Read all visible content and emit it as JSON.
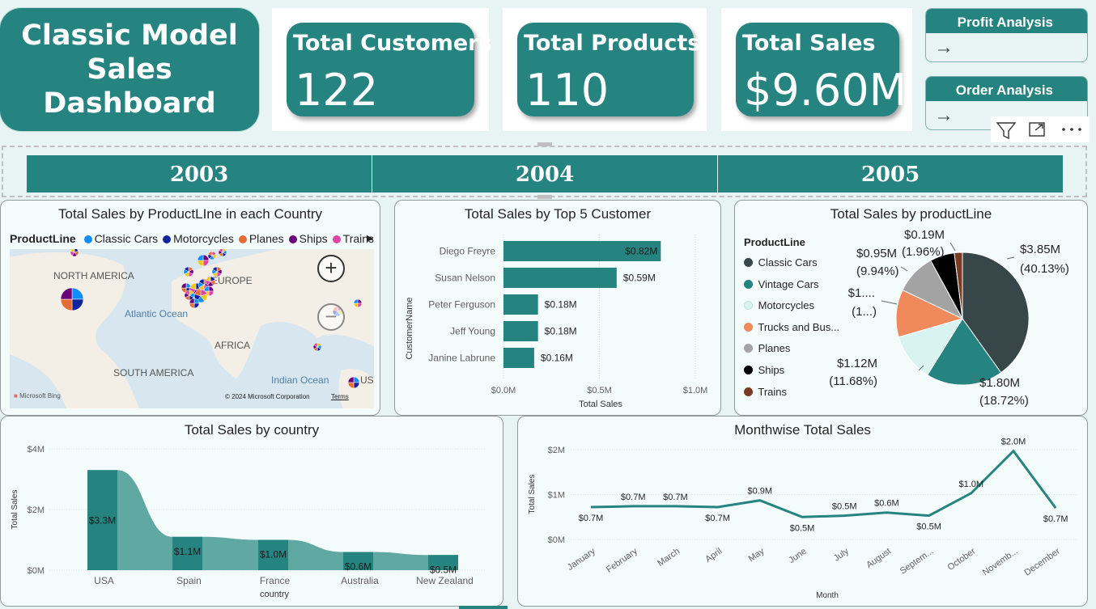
{
  "header": {
    "title_line1": "Classic Model",
    "title_line2": "Sales Dashboard"
  },
  "kpis": [
    {
      "label": "Total Customers",
      "value": "122"
    },
    {
      "label": "Total Products",
      "value": "110"
    },
    {
      "label": "Total Sales",
      "value": "$9.60M"
    }
  ],
  "nav": {
    "profit_label": "Profit Analysis",
    "order_label": "Order Analysis",
    "arrow_icon": "arrow-right-icon"
  },
  "visual_toolbar": {
    "filter_icon": "filter-icon",
    "focus_icon": "focus-mode-icon",
    "more_icon": "more-options-icon"
  },
  "year_slicer": {
    "years": [
      "2003",
      "2004",
      "2005"
    ]
  },
  "map_panel": {
    "title": "Total Sales by ProductLIne in each Country",
    "legend_title": "ProductLine",
    "legend": [
      {
        "label": "Classic Cars",
        "color": "#118DFF"
      },
      {
        "label": "Motorcycles",
        "color": "#12239E"
      },
      {
        "label": "Planes",
        "color": "#E66C37"
      },
      {
        "label": "Ships",
        "color": "#6B007B"
      },
      {
        "label": "Trains",
        "color": "#E044A7"
      }
    ],
    "labels": {
      "north_america": "NORTH AMERICA",
      "europe": "EUROPE",
      "atlantic": "Atlantic Ocean",
      "africa": "AFRICA",
      "south_america": "SOUTH AMERICA",
      "indian": "Indian Ocean",
      "asia_cut": "USTI",
      "bing": "Microsoft Bing",
      "copyright": "© 2024 Microsoft Corporation",
      "terms": "Terms"
    },
    "zoom_in": "+",
    "zoom_out": "−"
  },
  "chart_data": [
    {
      "type": "bar",
      "orientation": "horizontal",
      "title": "Total Sales by Top 5 Customer",
      "xlabel": "Total Sales",
      "ylabel": "CustomerName",
      "categories": [
        "Diego Freyre",
        "Susan Nelson",
        "Peter Ferguson",
        "Jeff Young",
        "Janine Labrune"
      ],
      "values": [
        0.82,
        0.59,
        0.18,
        0.18,
        0.16
      ],
      "value_labels": [
        "$0.82M",
        "$0.59M",
        "$0.18M",
        "$0.18M",
        "$0.16M"
      ],
      "xlim": [
        0,
        1.0
      ],
      "xticks": [
        "$0.0M",
        "$0.5M",
        "$1.0M"
      ],
      "color": "#268480"
    },
    {
      "type": "pie",
      "title": "Total Sales by productLine",
      "legend_title": "ProductLine",
      "legend_position": "left",
      "slices": [
        {
          "label": "Classic Cars",
          "value": 40.13,
          "color": "#374649",
          "value_label": "$3.85M",
          "pct_label": "(40.13%)"
        },
        {
          "label": "Vintage Cars",
          "value": 18.72,
          "color": "#268480",
          "value_label": "$1.80M",
          "pct_label": "(18.72%)"
        },
        {
          "label": "Motorcycles",
          "value": 11.68,
          "color": "#d9f3f1",
          "value_label": "$1.12M",
          "pct_label": "(11.68%)"
        },
        {
          "label": "Trucks and Bus...",
          "value": 11.57,
          "color": "#f08a5d",
          "value_label": "$1....",
          "pct_label": "(1...)"
        },
        {
          "label": "Planes",
          "value": 9.94,
          "color": "#a3a3a3",
          "value_label": "$0.95M",
          "pct_label": "(9.94%)"
        },
        {
          "label": "Ships",
          "value": 6.0,
          "color": "#000000",
          "value_label": "",
          "pct_label": ""
        },
        {
          "label": "Trains",
          "value": 1.96,
          "color": "#7a3b22",
          "value_label": "$0.19M",
          "pct_label": "(1.96%)"
        }
      ]
    },
    {
      "type": "area",
      "title": "Total Sales by country",
      "xlabel": "country",
      "ylabel": "Total Sales",
      "categories": [
        "USA",
        "Spain",
        "France",
        "Australia",
        "New Zealand"
      ],
      "values": [
        3.3,
        1.1,
        1.0,
        0.6,
        0.5
      ],
      "value_labels": [
        "$3.3M",
        "$1.1M",
        "$1.0M",
        "$0.6M",
        "$0.5M"
      ],
      "ylim": [
        0,
        4
      ],
      "yticks": [
        "$0M",
        "$2M",
        "$4M"
      ],
      "bar_color": "#268480",
      "ribbon_color": "#5fa9a2"
    },
    {
      "type": "line",
      "title": "Monthwise Total Sales",
      "xlabel": "Month",
      "ylabel": "Total Sales",
      "categories": [
        "January",
        "February",
        "March",
        "April",
        "May",
        "June",
        "July",
        "August",
        "Septem...",
        "October",
        "Novemb...",
        "December"
      ],
      "values": [
        0.72,
        0.74,
        0.74,
        0.72,
        0.87,
        0.5,
        0.53,
        0.6,
        0.53,
        1.03,
        1.97,
        0.7
      ],
      "value_labels": [
        "$0.7M",
        "$0.7M",
        "$0.7M",
        "$0.7M",
        "$0.9M",
        "$0.5M",
        "$0.5M",
        "$0.6M",
        "$0.5M",
        "$1.0M",
        "$2.0M",
        "$0.7M"
      ],
      "ylim": [
        0,
        2
      ],
      "yticks": [
        "$0M",
        "$1M",
        "$2M"
      ],
      "color": "#268480"
    }
  ]
}
